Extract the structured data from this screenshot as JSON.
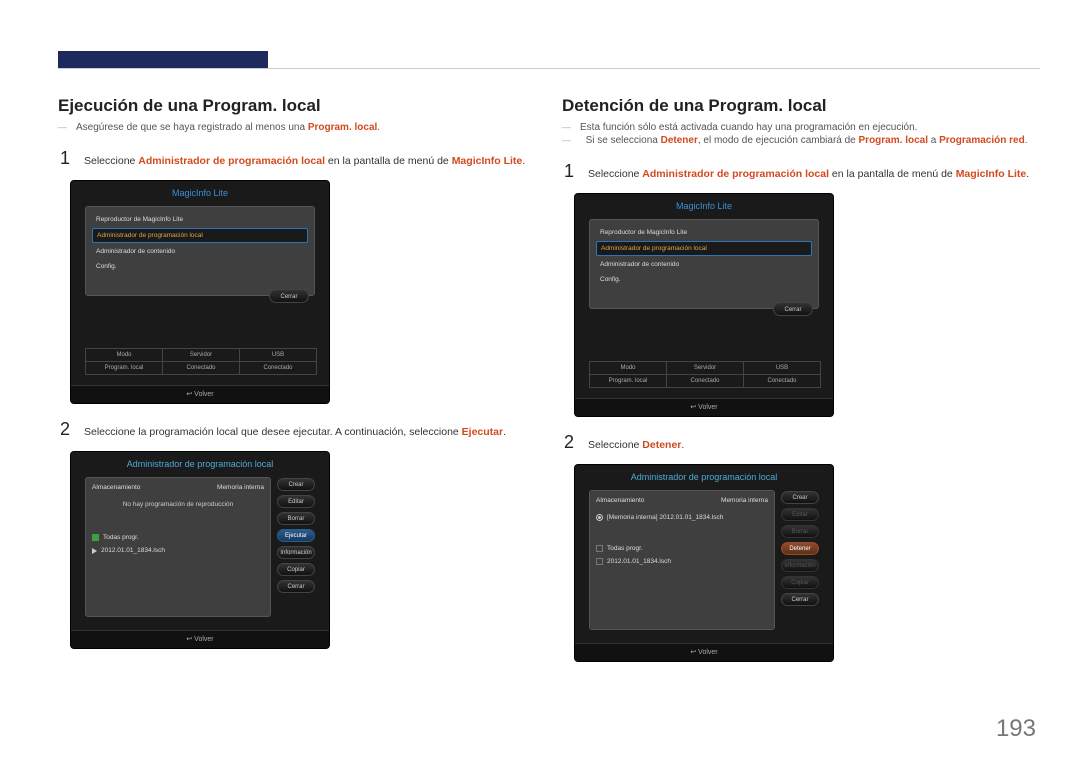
{
  "page_number": "193",
  "left": {
    "title": "Ejecución de una Program. local",
    "note_pre": "Asegúrese de que se haya registrado al menos una ",
    "note_hl": "Program. local",
    "step1_pre": "Seleccione ",
    "step1_hl1": "Administrador de programación local",
    "step1_mid": " en la pantalla de menú de ",
    "step1_hl2": "MagicInfo Lite",
    "step2_pre": "Seleccione la programación local que desee ejecutar. A continuación, seleccione ",
    "step2_hl": "Ejecutar",
    "screen1": {
      "title": "MagicInfo Lite",
      "items": [
        "Reproductor de MagicInfo Lite",
        "Administrador de programación local",
        "Administrador de contenido",
        "Config."
      ],
      "close": "Cerrar",
      "status": {
        "h1": "Modo",
        "h2": "Servidor",
        "h3": "USB",
        "v1": "Program. local",
        "v2": "Conectado",
        "v3": "Conectado"
      },
      "return": "Volver"
    },
    "screen2": {
      "title": "Administrador de programación local",
      "storage_label": "Almacenamiento",
      "storage_val": "Memoria interna",
      "empty": "No hay programación de reproducción",
      "item1": "Todas progr.",
      "item2": "2012.01.01_1834.lsch",
      "btns": [
        "Crear",
        "Editar",
        "Borrar",
        "Ejecutar",
        "Información",
        "Copiar",
        "Cerrar"
      ],
      "return": "Volver"
    }
  },
  "right": {
    "title": "Detención de una Program. local",
    "note1": "Esta función sólo está activada cuando hay una programación en ejecución.",
    "note2_pre": "Si se selecciona ",
    "note2_hl1": "Detener",
    "note2_mid": ", el modo de ejecución cambiará de ",
    "note2_hl2": "Program. local",
    "note2_mid2": " a ",
    "note2_hl3": "Programación red",
    "step1_pre": "Seleccione ",
    "step1_hl1": "Administrador de programación local",
    "step1_mid": " en la pantalla de menú de ",
    "step1_hl2": "MagicInfo Lite",
    "step2_pre": "Seleccione ",
    "step2_hl": "Detener",
    "screen1": {
      "title": "MagicInfo Lite",
      "items": [
        "Reproductor de MagicInfo Lite",
        "Administrador de programación local",
        "Administrador de contenido",
        "Config."
      ],
      "close": "Cerrar",
      "status": {
        "h1": "Modo",
        "h2": "Servidor",
        "h3": "USB",
        "v1": "Program. local",
        "v2": "Conectado",
        "v3": "Conectado"
      },
      "return": "Volver"
    },
    "screen2": {
      "title": "Administrador de programación local",
      "storage_label": "Almacenamiento",
      "storage_val": "Memoria interna",
      "playing": "[Memoria interna] 2012.01.01_1834.lsch",
      "item1": "Todas progr.",
      "item2": "2012.01.01_1834.lsch",
      "btns": [
        "Crear",
        "Editar",
        "Borrar",
        "Detener",
        "Información",
        "Copiar",
        "Cerrar"
      ],
      "return": "Volver"
    }
  }
}
